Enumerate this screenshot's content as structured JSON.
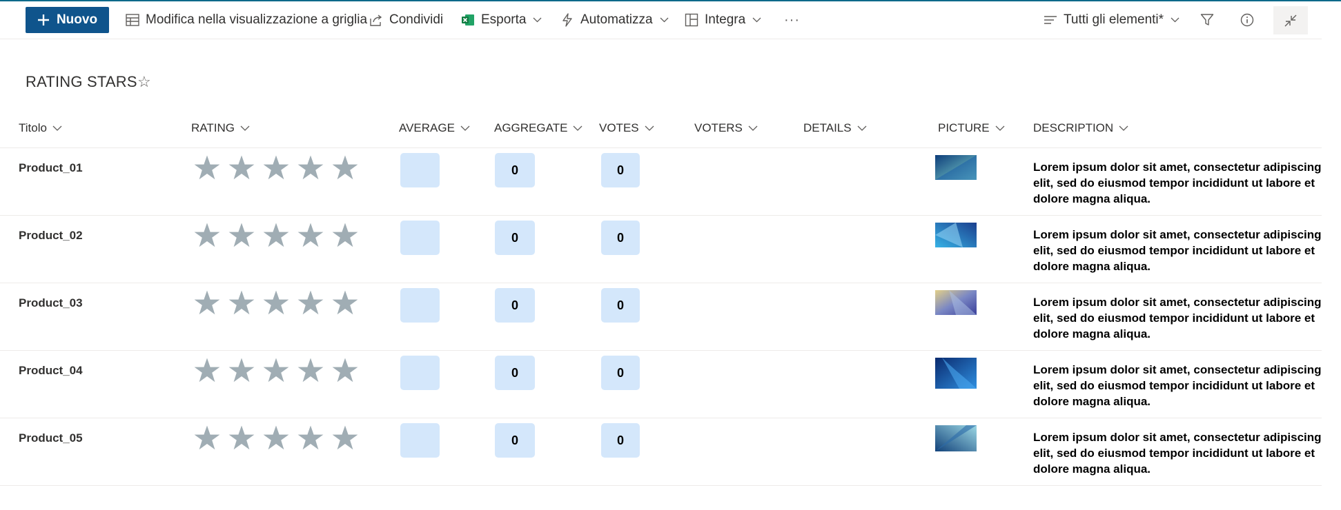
{
  "toolbar": {
    "new_label": "Nuovo",
    "grid_edit_label": "Modifica nella visualizzazione a griglia",
    "share_label": "Condividi",
    "export_label": "Esporta",
    "automate_label": "Automatizza",
    "integrate_label": "Integra",
    "more_label": "···",
    "view_label": "Tutti gli elementi*"
  },
  "page": {
    "title": "RATING STARS"
  },
  "columns": {
    "titolo": "Titolo",
    "rating": "RATING",
    "average": "AVERAGE",
    "aggregate": "AGGREGATE",
    "votes": "VOTES",
    "voters": "VOTERS",
    "details": "DETAILS",
    "picture": "PICTURE",
    "description": "DESCRIPTION"
  },
  "rows": [
    {
      "title": "Product_01",
      "rating_stars_filled": 0,
      "rating_stars_total": 5,
      "average": "",
      "aggregate": "0",
      "votes": "0",
      "voters": "",
      "details": "",
      "description": "Lorem ipsum dolor sit amet, consectetur adipiscing elit, sed do eiusmod tempor incididunt ut labore et dolore magna aliqua."
    },
    {
      "title": "Product_02",
      "rating_stars_filled": 0,
      "rating_stars_total": 5,
      "average": "",
      "aggregate": "0",
      "votes": "0",
      "voters": "",
      "details": "",
      "description": "Lorem ipsum dolor sit amet, consectetur adipiscing elit, sed do eiusmod tempor incididunt ut labore et dolore magna aliqua."
    },
    {
      "title": "Product_03",
      "rating_stars_filled": 0,
      "rating_stars_total": 5,
      "average": "",
      "aggregate": "0",
      "votes": "0",
      "voters": "",
      "details": "",
      "description": "Lorem ipsum dolor sit amet, consectetur adipiscing elit, sed do eiusmod tempor incididunt ut labore et dolore magna aliqua."
    },
    {
      "title": "Product_04",
      "rating_stars_filled": 0,
      "rating_stars_total": 5,
      "average": "",
      "aggregate": "0",
      "votes": "0",
      "voters": "",
      "details": "",
      "description": "Lorem ipsum dolor sit amet, consectetur adipiscing elit, sed do eiusmod tempor incididunt ut labore et dolore magna aliqua."
    },
    {
      "title": "Product_05",
      "rating_stars_filled": 0,
      "rating_stars_total": 5,
      "average": "",
      "aggregate": "0",
      "votes": "0",
      "voters": "",
      "details": "",
      "description": "Lorem ipsum dolor sit amet, consectetur adipiscing elit, sed do eiusmod tempor incididunt ut labore et dolore magna aliqua."
    }
  ],
  "colors": {
    "accent": "#0f548c",
    "star_empty": "#a0adb4",
    "value_box": "#d4e7fb",
    "excel_green": "#107c41"
  },
  "icons": [
    "add-icon",
    "grid-icon",
    "share-icon",
    "excel-icon",
    "automate-icon",
    "integrate-icon",
    "more-icon",
    "view-list-icon",
    "filter-icon",
    "info-icon",
    "collapse-icon",
    "favorite-star-icon",
    "chevron-down-icon",
    "star-icon"
  ]
}
